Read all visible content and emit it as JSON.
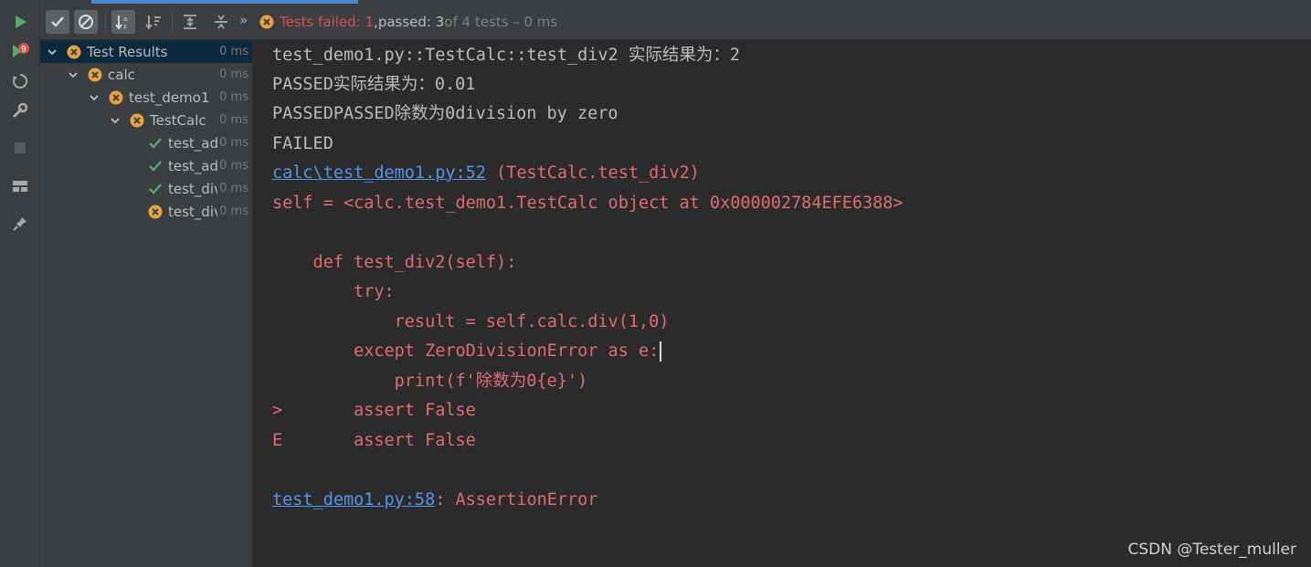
{
  "toolbar": {
    "status_icon": "error-circle-icon",
    "status_failed": "Tests failed: 1",
    "status_sep": ", ",
    "status_passed": "passed: 3",
    "status_rest": " of 4 tests – 0 ms",
    "expand_chevron": "»"
  },
  "tree": {
    "rows": [
      {
        "label": "Test Results",
        "duration": "0 ms",
        "status": "failed"
      },
      {
        "label": "calc",
        "duration": "0 ms",
        "status": "failed"
      },
      {
        "label": "test_demo1",
        "duration": "0 ms",
        "status": "failed"
      },
      {
        "label": "TestCalc",
        "duration": "0 ms",
        "status": "failed"
      },
      {
        "label": "test_add",
        "duration": "0 ms",
        "status": "passed"
      },
      {
        "label": "test_add",
        "duration": "0 ms",
        "status": "passed"
      },
      {
        "label": "test_div",
        "duration": "0 ms",
        "status": "passed"
      },
      {
        "label": "test_div",
        "duration": "0 ms",
        "status": "failed"
      }
    ]
  },
  "console": {
    "l1": "test_demo1.py::TestCalc::test_div2 实际结果为：2",
    "l2": "PASSED实际结果为：0.01",
    "l3": "PASSEDPASSED除数为0division by zero",
    "l4": "FAILED",
    "l5_link": "calc\\test_demo1.py:52",
    "l5_rest": " (TestCalc.test_div2)",
    "l6": "self = <calc.test_demo1.TestCalc object at 0x000002784EFE6388>",
    "l7": "    def test_div2(self):",
    "l8": "        try:",
    "l9": "            result = self.calc.div(1,0)",
    "l10": "        except ZeroDivisionError as e:",
    "l11": "            print(f'除数为0{e}')",
    "l12": ">       assert False",
    "l13": "E       assert False",
    "l14_link": "test_demo1.py:58",
    "l14_rest": ": AssertionError"
  },
  "watermark": "CSDN @Tester_muller",
  "colors": {
    "failed": "#d25252",
    "passed": "#59a869",
    "link": "#5394ec",
    "error_text": "#e06c6c",
    "warning_icon": "#e8a33e"
  }
}
